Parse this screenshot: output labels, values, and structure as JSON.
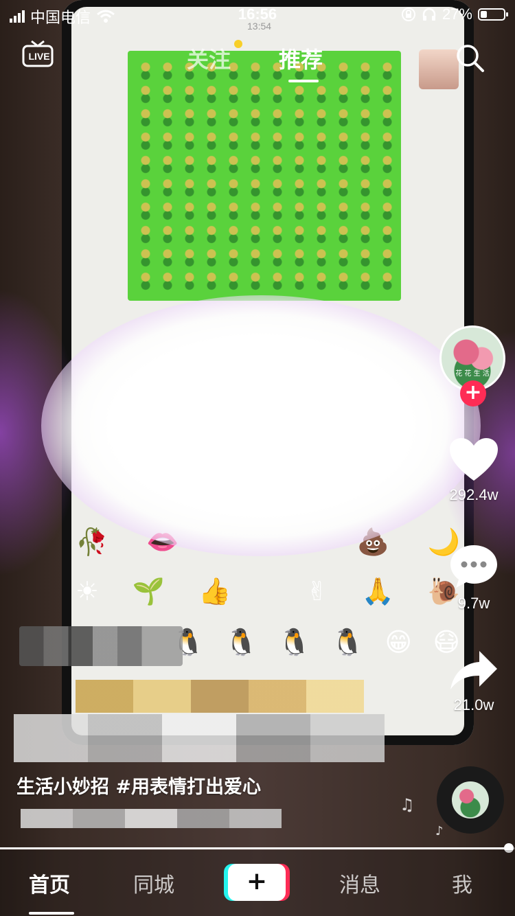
{
  "status_bar": {
    "carrier": "中国电信",
    "time": "16:56",
    "battery_percent": "27%",
    "battery_level": 0.27
  },
  "video_overlay": {
    "screen_time": "13:54"
  },
  "top_nav": {
    "live_label": "LIVE",
    "follow_tab": "关注",
    "recommend_tab": "推荐",
    "active_tab": "推荐"
  },
  "right_rail": {
    "likes": "292.4w",
    "comments": "9.7w",
    "shares": "21.0w",
    "follow_plus": "+",
    "author_avatar_text": "花 花 生 活"
  },
  "caption": {
    "text": "生活小妙招 #用表情打出爱心"
  },
  "progress": {
    "fraction": 0.99
  },
  "bottom_nav": {
    "home": "首页",
    "nearby": "同城",
    "create": "+",
    "inbox": "消息",
    "me": "我"
  },
  "colors": {
    "accent": "#fe2c55",
    "cyan": "#25f4ee",
    "notify_dot": "#f8cf28"
  }
}
